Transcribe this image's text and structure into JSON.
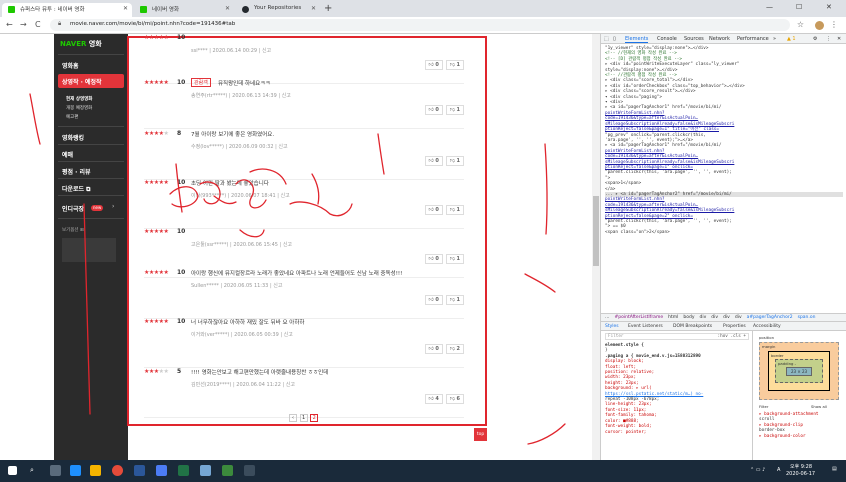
{
  "browser": {
    "tabs": [
      {
        "title": "슈퍼스타 뮤투 : 네이버 영화",
        "color": "#1ec800",
        "active": true
      },
      {
        "title": "네이버 영화",
        "color": "#1ec800",
        "active": false
      },
      {
        "title": "Your Repositories",
        "color": "#24292e",
        "active": false
      }
    ],
    "new_tab_label": "+",
    "window_controls": [
      "—",
      "☐",
      "✕"
    ],
    "url": "movie.naver.com/movie/bi/mi/point.nhn?code=191436#tab",
    "nav_back": "←",
    "nav_forward": "→",
    "nav_reload": "C",
    "bookmark_icon": "☆",
    "menu_icon": "⋮"
  },
  "sidebar": {
    "logo_naver": "NAVER",
    "logo_movie": "영화",
    "items": [
      {
        "label": "영화홈",
        "highlight": false
      },
      {
        "label": "상영작 · 예정작",
        "highlight": true
      },
      {
        "label": "영화랭킹",
        "highlight": false
      },
      {
        "label": "예매",
        "highlight": false
      },
      {
        "label": "평점 · 리뷰",
        "highlight": false
      },
      {
        "label": "다운로드 ⧉",
        "highlight": false
      },
      {
        "label": "인디극장",
        "highlight": false
      }
    ],
    "sub_items": [
      "현재 상영영화",
      "개봉 예정영화",
      "예고편"
    ],
    "indie_badge": "new",
    "indie_chevron": "›",
    "extra_label": "보기옵션 ⊞"
  },
  "reviews": [
    {
      "stars": 5,
      "score": "10",
      "badge": "",
      "text": "",
      "meta": "ssi****  |  2020.06.14 00:29  |  신고",
      "up": "0",
      "down": "1"
    },
    {
      "stars": 5,
      "score": "10",
      "badge": "관람객",
      "text": "뮤직왕인데 하네요ㅋㅋ",
      "meta": "송연주(rtr*****)  |  2020.06.13 14:39  |  신고",
      "up": "0",
      "down": "1"
    },
    {
      "stars": 4,
      "score": "8",
      "badge": "",
      "text": "7월 아이랑 보기에 좋은 영화였어요.",
      "meta": "수정(lov*****)  |  2020.06.09 00:32  |  신고",
      "up": "0",
      "down": "1"
    },
    {
      "stars": 5,
      "score": "10",
      "badge": "",
      "text": "초딩 어린 딸과 봤는데 좋았습니다",
      "meta": "이나(993*****)  |  2020.06.07 18:41  |  신고",
      "up": "0",
      "down": "1"
    },
    {
      "stars": 5,
      "score": "10",
      "badge": "",
      "text": "",
      "meta": "고은툴(ssr*****)  |  2020.06.06 15:45  |  신고",
      "up": "0",
      "down": "1"
    },
    {
      "stars": 5,
      "score": "10",
      "badge": "",
      "text": "아이랑 행신에 뮤지컬장르라 노래가 좋았네요 아파트나 노래 언제들어도 신남 노래 중독성!!!",
      "meta": "Sullen*****  |  2020.06.05 11:33  |  신고",
      "up": "0",
      "down": "1"
    },
    {
      "stars": 5,
      "score": "10",
      "badge": "",
      "text": "너 너무하잖아요 아하하 재밌 잘도 뒤바 요 아하하",
      "meta": "이거와(ver*****)  |  2020.06.05 00:39  |  신고",
      "up": "0",
      "down": "2"
    },
    {
      "stars": 3,
      "score": "5",
      "badge": "",
      "text": "!!!! 영화는안보고 해고편만했는데 아랫줄내용칭찬 ㅎㅎ인데",
      "meta": "김민선(2019****)  |  2020.06.04 11:22  |  신고",
      "up": "4",
      "down": "6"
    }
  ],
  "pager": {
    "prev": "‹",
    "pages": [
      "1",
      "2"
    ],
    "current": "2"
  },
  "top_button": "top",
  "devtools": {
    "tabs": [
      "Elements",
      "Console",
      "Sources",
      "Network",
      "Performance",
      "»"
    ],
    "warning_badge": "▲ 1",
    "dom_lines": [
      {
        "cls": "",
        "text": "  \"1y_viewer\" style=\"display:none\">…</div>"
      },
      {
        "cls": "cm",
        "text": "  <!-- //현재의 영화 작성 완료 -->"
      },
      {
        "cls": "cm",
        "text": "  <!-- [D] 관람객 평점 작성 완료 -->"
      },
      {
        "cls": "",
        "text": "▸ <div id=\"pointWriteExecuteLayer\" class=\"ly_viewer\""
      },
      {
        "cls": "",
        "text": "  style=\"display:none\">…</div>"
      },
      {
        "cls": "cm",
        "text": "  <!-- //관람객 평점 작성 완료 -->"
      },
      {
        "cls": "",
        "text": "▸ <div class=\"score_total\">…</div>"
      },
      {
        "cls": "",
        "text": "▸ <div id=\"orderCheckbox\" class=\"top_behavior\">…</div>"
      },
      {
        "cls": "",
        "text": "▸ <div class=\"score_result\">…</div>"
      },
      {
        "cls": "",
        "text": "▾ <div class=\"paging\">"
      },
      {
        "cls": "",
        "text": "   ▾ <div>"
      },
      {
        "cls": "",
        "text": "     ▸ <a id=\"pagerTagAnchor1\" href=\"/movie/bi/mi/"
      },
      {
        "cls": "lk",
        "text": "       pointWriteFormList.nhn?"
      },
      {
        "cls": "lk",
        "text": "       code=191436&type=after&isActualPoin…"
      },
      {
        "cls": "lk",
        "text": "       sMileageSubscriptionAlready=false&isMileageSubscri"
      },
      {
        "cls": "lk",
        "text": "       ptionReject=false&page=1\" title=\"이전\" class="
      },
      {
        "cls": "",
        "text": "       \"pg_prev\" onclick=\"parent.clickcr(this,"
      },
      {
        "cls": "",
        "text": "       'ara.page', '', '', event);\">…</a>"
      },
      {
        "cls": "",
        "text": "     ▸ <a id=\"pagerTagAnchor1\" href=\"/movie/bi/mi/"
      },
      {
        "cls": "lk",
        "text": "       pointWriteFormList.nhn?"
      },
      {
        "cls": "lk",
        "text": "       code=191436&type=after&isActualPoin…"
      },
      {
        "cls": "lk",
        "text": "       sMileageSubscriptionAlready=false&isMileageSubscri"
      },
      {
        "cls": "lk",
        "text": "       ptionReject=false&page=1\" onclick="
      },
      {
        "cls": "",
        "text": "       \"parent.clickcr(this, 'ara.page', '', '', event);"
      },
      {
        "cls": "",
        "text": "       \">"
      },
      {
        "cls": "",
        "text": "         <span>1</span>"
      },
      {
        "cls": "",
        "text": "       </a>"
      },
      {
        "cls": "sel",
        "text": "...  ▸ <a id=\"pagerTagAnchor2\" href=\"/movie/bi/mi/"
      },
      {
        "cls": "lk",
        "text": "       pointWriteFormList.nhn?"
      },
      {
        "cls": "lk",
        "text": "       code=191436&type=after&isActualPoin…"
      },
      {
        "cls": "lk",
        "text": "       sMileageSubscriptionAlready=false&isMileageSubscri"
      },
      {
        "cls": "lk",
        "text": "       ptionReject=false&page=2\" onclick="
      },
      {
        "cls": "",
        "text": "       \"parent.clickcr(this, 'ara.page', '', '', event);"
      },
      {
        "cls": "",
        "text": "       \"> == $0"
      },
      {
        "cls": "",
        "text": "         <span class=\"on\">2</span>"
      }
    ],
    "breadcrumbs": [
      "…",
      "#pointAfterListIframe",
      "html",
      "body",
      "div",
      "div",
      "div",
      "div",
      "a#pagerTagAnchor2",
      "span.on"
    ],
    "style_tabs": [
      "Styles",
      "Event Listeners",
      "DOM Breakpoints",
      "Properties",
      "Accessibility"
    ],
    "filter_placeholder": "Filter",
    "filter_right": ":hov .cls +",
    "style_lines": [
      {
        "cls": "sel",
        "text": "element.style {"
      },
      {
        "cls": "",
        "text": "}"
      },
      {
        "cls": "sel",
        "text": ".paging a {                    movie_end.v.js=1580312890"
      },
      {
        "cls": "pn",
        "text": "  display: block;"
      },
      {
        "cls": "pn",
        "text": "  float: left;"
      },
      {
        "cls": "pn",
        "text": "  position: relative;"
      },
      {
        "cls": "pn",
        "text": "  width: 23px;"
      },
      {
        "cls": "pn",
        "text": "  height: 23px;"
      },
      {
        "cls": "pn",
        "text": "  background: ▸ url("
      },
      {
        "cls": "lk",
        "text": "    https://ssl.pstatic.net/static/m…) no-"
      },
      {
        "cls": "",
        "text": "    repeat -108px -678px;"
      },
      {
        "cls": "pn",
        "text": "  line-height: 23px;"
      },
      {
        "cls": "pn",
        "text": "  font-size: 11px;"
      },
      {
        "cls": "pn",
        "text": "  font-family: tahoma;"
      },
      {
        "cls": "pn",
        "text": "  color: ■#888;"
      },
      {
        "cls": "pn",
        "text": "  font-weight: bold;"
      },
      {
        "cls": "pn",
        "text": "  cursor: pointer;"
      }
    ],
    "box_model": {
      "position_label": "position",
      "margin_label": "margin",
      "border_label": "border",
      "padding_label": "padding -",
      "content": "23 × 23",
      "filter_label": "Filter",
      "show_all": "Show all",
      "props": [
        "▸ background-attachment",
        "  scroll",
        "▸ background-clip",
        "  border-box",
        "▸ background-color"
      ]
    }
  },
  "taskbar": {
    "time": "오후 9:28",
    "date": "2020-06-17",
    "ime": "A"
  }
}
